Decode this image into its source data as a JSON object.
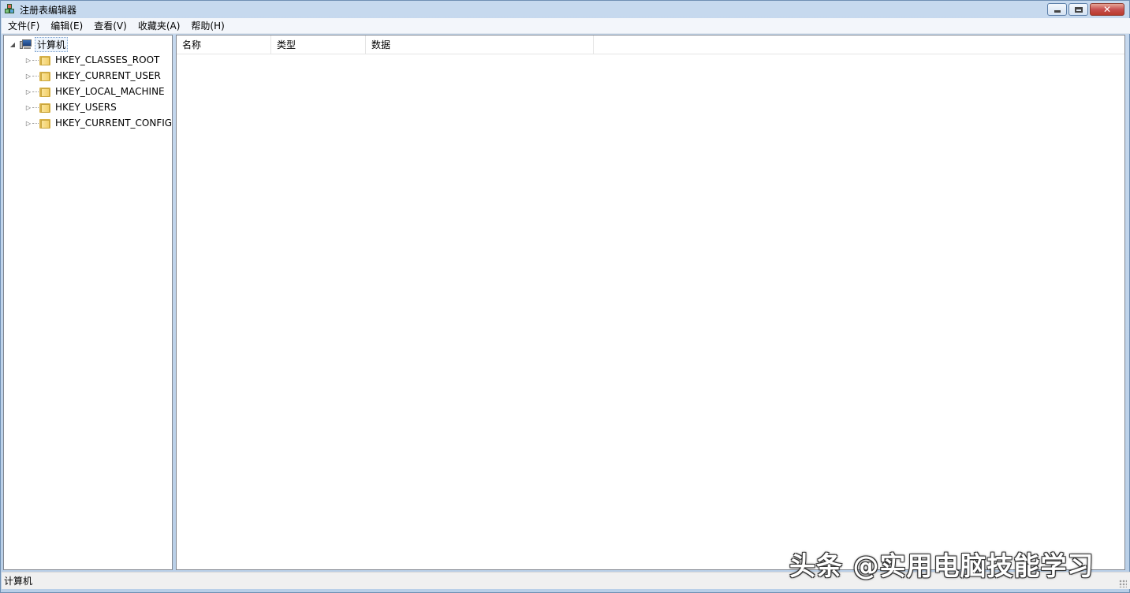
{
  "window": {
    "title": "注册表编辑器"
  },
  "menu": {
    "items": [
      {
        "label": "文件(F)"
      },
      {
        "label": "编辑(E)"
      },
      {
        "label": "查看(V)"
      },
      {
        "label": "收藏夹(A)"
      },
      {
        "label": "帮助(H)"
      }
    ]
  },
  "tree": {
    "root": {
      "label": "计算机",
      "expanded": true
    },
    "children": [
      {
        "label": "HKEY_CLASSES_ROOT"
      },
      {
        "label": "HKEY_CURRENT_USER"
      },
      {
        "label": "HKEY_LOCAL_MACHINE"
      },
      {
        "label": "HKEY_USERS"
      },
      {
        "label": "HKEY_CURRENT_CONFIG"
      }
    ]
  },
  "list": {
    "columns": [
      {
        "label": "名称"
      },
      {
        "label": "类型"
      },
      {
        "label": "数据"
      }
    ]
  },
  "status": {
    "text": "计算机"
  },
  "watermark": {
    "text": "头条 @实用电脑技能学习"
  }
}
